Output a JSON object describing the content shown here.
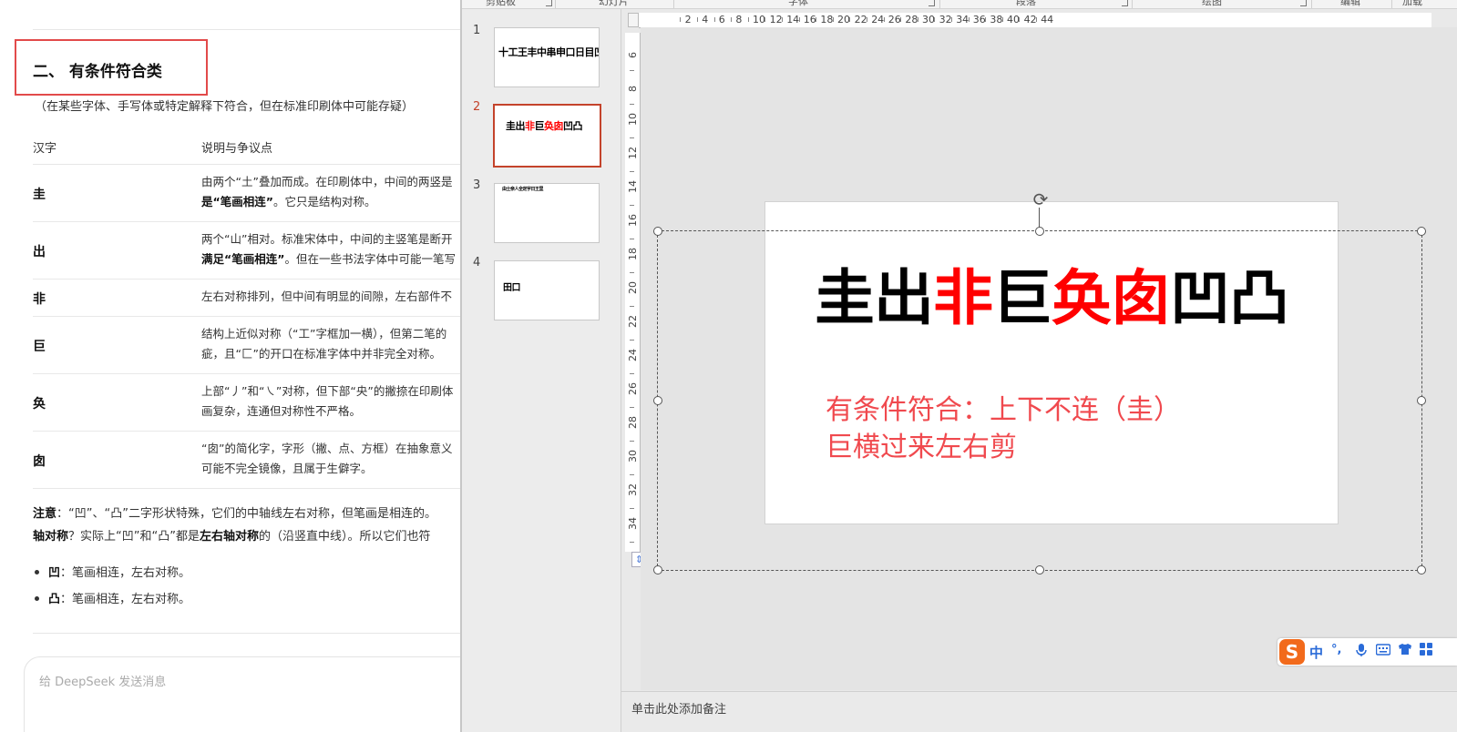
{
  "chat": {
    "section_title": "二、 有条件符合类",
    "section_note": "（在某些字体、手写体或特定解释下符合，但在标准印刷体中可能存疑）",
    "table": {
      "headers": [
        "汉字",
        "说明与争议点"
      ],
      "rows": [
        {
          "char": "圭",
          "line1": "由两个“土”叠加而成。在印刷体中，中间的两竖是",
          "line2_bold": "是“笔画相连”",
          "line2_rest": "。它只是结构对称。"
        },
        {
          "char": "出",
          "line1": "两个“山”相对。标准宋体中，中间的主竖笔是断开",
          "line2_bold": "满足“笔画相连”",
          "line2_rest": "。但在一些书法字体中可能一笔写"
        },
        {
          "char": "非",
          "line1": "左右对称排列，但中间有明显的间隙，左右部件不",
          "line2_bold": "",
          "line2_rest": ""
        },
        {
          "char": "巨",
          "line1": "结构上近似对称（“工”字框加一横），但第二笔的",
          "line2_bold": "",
          "line2_rest": "疵，且“匚”的开口在标准字体中并非完全对称。"
        },
        {
          "char": "奂",
          "line1": "上部“丿”和“㇏”对称，但下部“央”的撇捺在印刷体",
          "line2_bold": "",
          "line2_rest": "画复杂，连通但对称性不严格。"
        },
        {
          "char": "囱",
          "line1": "“囱”的简化字，字形（撇、点、方框）在抽象意义",
          "line2_bold": "",
          "line2_rest": "可能不完全镜像，且属于生僻字。"
        }
      ]
    },
    "note": {
      "label": "注意",
      "line1_rest": "：“凹”、“凸”二字形状特殊，它们的中轴线左右对称，但笔画是相连的。",
      "line2_bold1": "轴对称",
      "line2_mid": "？实际上“凹”和“凸”都是",
      "line2_bold2": "左右轴对称",
      "line2_rest": "的（沿竖直中线）。所以它们也符"
    },
    "bullets": [
      {
        "char": "凹",
        "text": "：笔画相连，左右对称。"
      },
      {
        "char": "凸",
        "text": "：笔画相连，左右对称。"
      }
    ],
    "input_placeholder": "给 DeepSeek 发送消息"
  },
  "ppt": {
    "ribbon_groups": [
      "剪贴板",
      "幻灯片",
      "字体",
      "段落",
      "绘图",
      "编辑",
      "加载"
    ],
    "slides": [
      {
        "num": "1",
        "thumb_text": "十工王丰中串申口日目凹",
        "selected": false
      },
      {
        "num": "2",
        "thumb_text": "圭出非巨奂囱凹凸",
        "selected": true
      },
      {
        "num": "3",
        "thumb_text": "由士亲人全定宇日王里",
        "selected": false
      },
      {
        "num": "4",
        "thumb_text": "田口",
        "selected": false
      }
    ],
    "ruler_h_labels": [
      "2",
      "4",
      "6",
      "8",
      "10",
      "12",
      "14",
      "16",
      "18",
      "20",
      "22",
      "24",
      "26",
      "28",
      "30",
      "32",
      "34",
      "36",
      "38",
      "40",
      "42",
      "44"
    ],
    "ruler_v_labels": [
      "6",
      "8",
      "10",
      "12",
      "14",
      "16",
      "18",
      "20",
      "22",
      "24",
      "26",
      "28",
      "30",
      "32",
      "34"
    ],
    "slide": {
      "title_chars": [
        {
          "ch": "圭",
          "color": "#000000"
        },
        {
          "ch": "出",
          "color": "#000000"
        },
        {
          "ch": "非",
          "color": "#ff0000"
        },
        {
          "ch": "巨",
          "color": "#000000"
        },
        {
          "ch": "奂",
          "color": "#ff0000"
        },
        {
          "ch": "囱",
          "color": "#ff0000"
        },
        {
          "ch": "凹",
          "color": "#000000"
        },
        {
          "ch": "凸",
          "color": "#000000"
        }
      ],
      "body_line1": "有条件符合：上下不连（圭）",
      "body_line2": "巨横过来左右剪"
    },
    "notes_placeholder": "单击此处添加备注",
    "ime": {
      "logo": "S",
      "lang": "中",
      "punct": "°,",
      "icons": [
        "mic-icon",
        "keyboard-icon",
        "skin-icon",
        "toolbox-icon"
      ]
    }
  }
}
